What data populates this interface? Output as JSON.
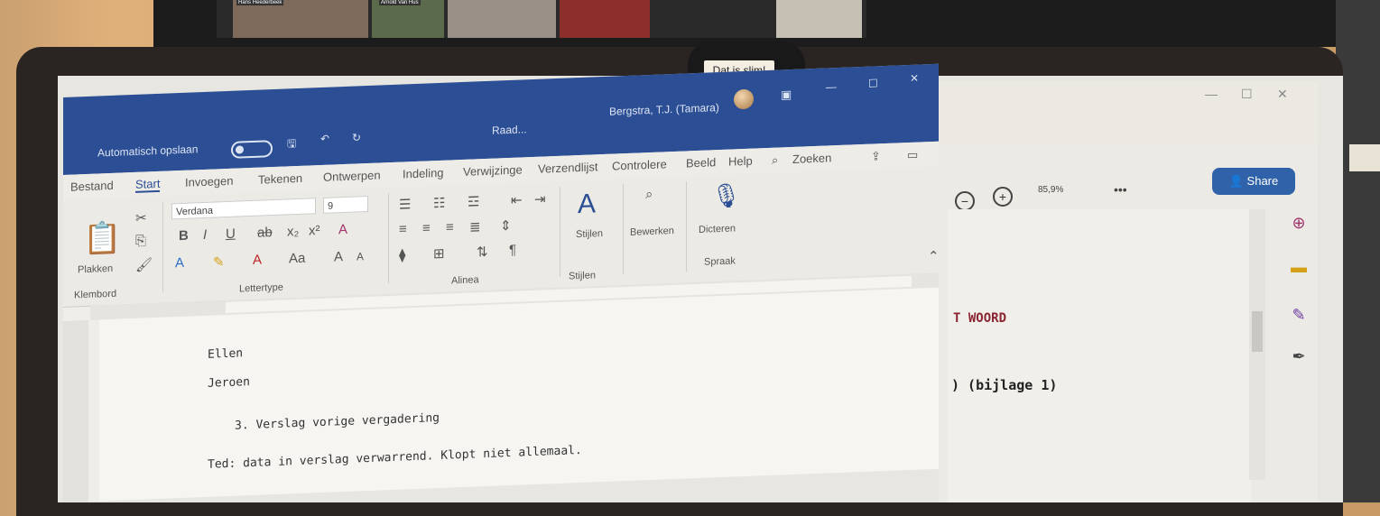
{
  "background": {
    "zoom_names": [
      "Hans Heederbeek",
      "Arnold Van Hus"
    ],
    "tooltip": "Dat is slim!"
  },
  "word": {
    "title_bar": {
      "autosave_label": "Automatisch opslaan",
      "doc_name": "Raad...",
      "user_name": "Bergstra, T.J. (Tamara)"
    },
    "menu_tabs": [
      "Bestand",
      "Start",
      "Invoegen",
      "Tekenen",
      "Ontwerpen",
      "Indeling",
      "Verwijzinge",
      "Verzendlijst",
      "Controlere",
      "Beeld",
      "Help"
    ],
    "search_label": "Zoeken",
    "ribbon": {
      "paste_label": "Plakken",
      "clipboard_group": "Klembord",
      "font_name": "Verdana",
      "font_size": "9",
      "font_group": "Lettertype",
      "paragraph_group": "Alinea",
      "styles_label": "Stijlen",
      "styles_group": "Stijlen",
      "edit_label": "Bewerken",
      "dictate_label": "Dicteren",
      "speech_group": "Spraak"
    },
    "document_lines": [
      "Ellen",
      "Jeroen",
      "3.  Verslag vorige vergadering",
      "Ted: data in verslag verwarrend. Klopt niet allemaal."
    ]
  },
  "right_window": {
    "zoom_level": "85,9%",
    "share_label": "Share",
    "text_woord": "T WOORD",
    "text_bijlage": ") (bijlage 1)"
  },
  "colors": {
    "word_blue": "#2b4e95",
    "share_blue": "#2f62a8",
    "accent_red": "#8a2430"
  }
}
